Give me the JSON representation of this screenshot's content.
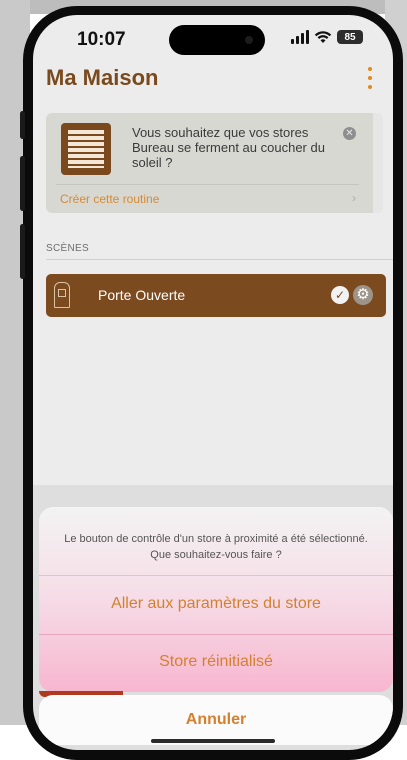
{
  "status_bar": {
    "time": "10:07",
    "battery": "85"
  },
  "header": {
    "title": "Ma Maison",
    "menu_icon": "kebab-menu-icon"
  },
  "suggestion_card": {
    "icon": "window-blind-icon",
    "text": "Vous souhaitez que vos stores Bureau se ferment au coucher du soleil ?",
    "close_icon": "close-icon",
    "link_label": "Créer cette routine",
    "chevron": "›"
  },
  "scenes": {
    "section_label": "SCÈNES",
    "items": [
      {
        "label": "Porte Ouverte",
        "icon": "door-icon",
        "status_icon": "check-icon",
        "settings_icon": "gear-icon"
      }
    ]
  },
  "action_sheet": {
    "message": "Le bouton de contrôle d'un store à proximité a été sélectionné. Que souhaitez-vous faire ?",
    "option_1": "Aller aux paramètres du store",
    "option_2": "Store réinitialisé",
    "cancel": "Annuler"
  },
  "colors": {
    "brand_brown": "#7c4a1f",
    "accent_orange": "#d4812f"
  }
}
